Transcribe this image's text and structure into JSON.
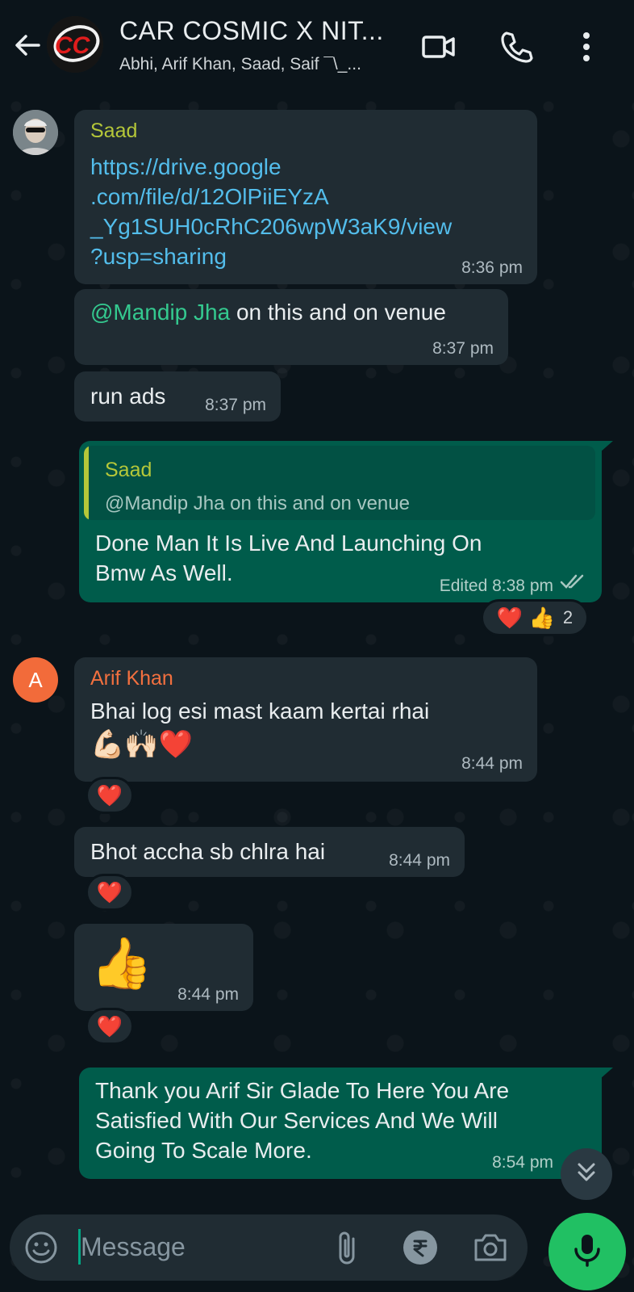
{
  "header": {
    "title": "CAR COSMIC X NIT...",
    "subtitle": "Abhi, Arif Khan, Saad, Saif ¯\\_...",
    "avatar_text": "CC"
  },
  "messages": {
    "m1": {
      "sender": "Saad",
      "link": "https://drive.google\n.com/file/d/12OlPiiEYzA\n_Yg1SUH0cRhC206wpW3aK9/view\n?usp=sharing",
      "time": "8:36 pm"
    },
    "m2": {
      "mention": "@Mandip Jha",
      "text": " on this and on venue",
      "time": "8:37 pm"
    },
    "m3": {
      "text": "run ads",
      "time": "8:37 pm"
    },
    "m4": {
      "quote_sender": "Saad",
      "quote_text": "@Mandip Jha on this and on venue",
      "text": "Done Man It Is Live And Launching On\nBmw As Well.",
      "edited": "Edited",
      "time": "8:38 pm",
      "reaction": "❤️ 👍",
      "reaction_count": "2"
    },
    "m5": {
      "avatar_letter": "A",
      "sender": "Arif Khan",
      "text": "Bhai log esi mast kaam kertai rhai",
      "emoji": "💪🏻🙌🏻❤️",
      "time": "8:44 pm",
      "reaction": "❤️"
    },
    "m6": {
      "text": "Bhot accha sb chlra hai",
      "time": "8:44 pm",
      "reaction": "❤️"
    },
    "m7": {
      "emoji": "👍",
      "time": "8:44 pm",
      "reaction": "❤️"
    },
    "m8": {
      "text": "Thank you Arif Sir Glade To Here You Are\nSatisfied With Our Services And We Will\nGoing To Scale More.",
      "time": "8:54 pm"
    }
  },
  "composer": {
    "placeholder": "Message"
  },
  "colors": {
    "background": "#0b141a",
    "incoming": "#202c33",
    "outgoing": "#005c4b",
    "accent": "#21c063",
    "saad_name": "#b5c739",
    "arif_name": "#f2703f"
  },
  "icons": [
    "back-arrow-icon",
    "video-call-icon",
    "phone-icon",
    "more-vert-icon",
    "emoji-icon",
    "attach-icon",
    "rupee-icon",
    "camera-icon",
    "mic-icon",
    "double-chevron-down-icon",
    "read-ticks-icon"
  ]
}
